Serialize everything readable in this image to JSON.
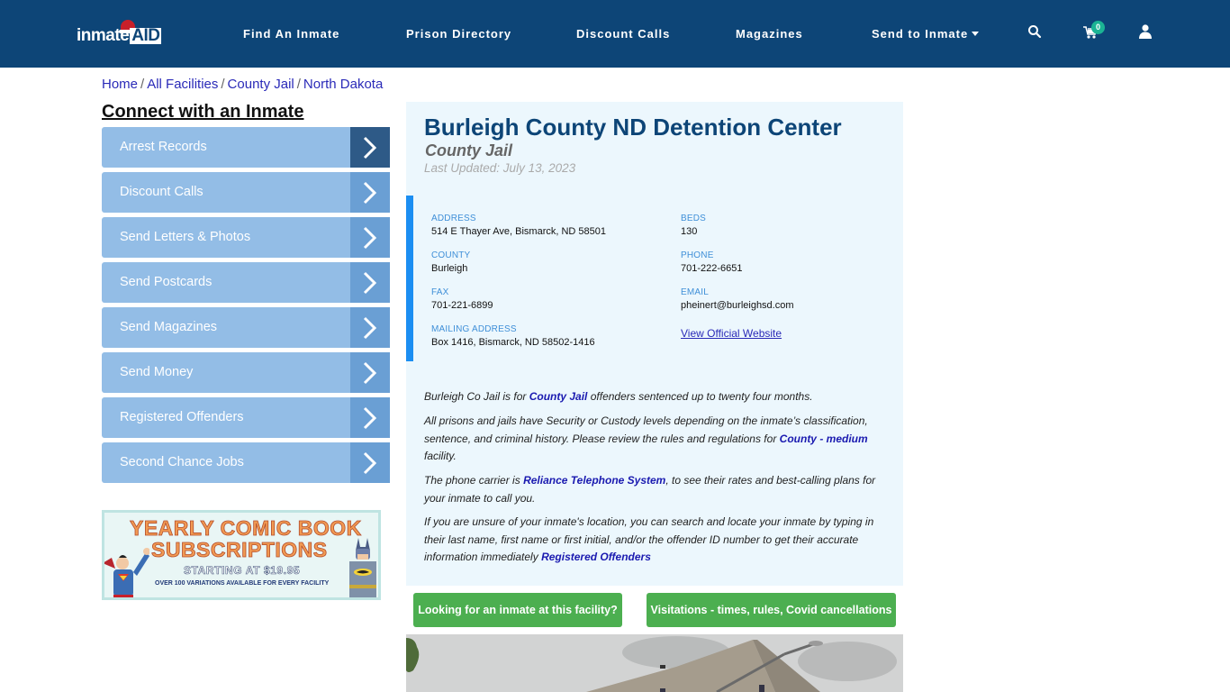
{
  "header": {
    "logo_text": "inmate",
    "logo_aid": "AID",
    "nav": [
      {
        "label": "Find An Inmate"
      },
      {
        "label": "Prison Directory"
      },
      {
        "label": "Discount Calls"
      },
      {
        "label": "Magazines"
      },
      {
        "label": "Send to Inmate",
        "has_dropdown": true
      }
    ],
    "icons": [
      "search-icon",
      "cart-icon",
      "user-icon"
    ],
    "cart_count": "0",
    "colors": {
      "bar": "#0d4577",
      "badge": "#1bb394"
    }
  },
  "breadcrumb": [
    {
      "label": "Home"
    },
    {
      "label": "All Facilities"
    },
    {
      "label": "County Jail"
    },
    {
      "label": "North Dakota"
    }
  ],
  "breadcrumb_sep": "/",
  "sidebar": {
    "title": "Connect with an Inmate",
    "items": [
      {
        "label": "Arrest Records"
      },
      {
        "label": "Discount Calls"
      },
      {
        "label": "Send Letters & Photos"
      },
      {
        "label": "Send Postcards"
      },
      {
        "label": "Send Magazines"
      },
      {
        "label": "Send Money"
      },
      {
        "label": "Registered Offenders"
      },
      {
        "label": "Second Chance Jobs"
      }
    ],
    "ad": {
      "line1": "YEARLY COMIC BOOK",
      "line2": "SUBSCRIPTIONS",
      "line3": "STARTING AT $19.95",
      "line4": "OVER 100 VARIATIONS AVAILABLE FOR EVERY FACILITY"
    }
  },
  "facility": {
    "title": "Burleigh County ND Detention Center",
    "type": "County Jail",
    "last_updated": "Last Updated: July 13, 2023",
    "info": {
      "address_label": "ADDRESS",
      "address": "514 E Thayer Ave, Bismarck, ND 58501",
      "beds_label": "BEDS",
      "beds": "130",
      "county_label": "COUNTY",
      "county": "Burleigh",
      "phone_label": "PHONE",
      "phone": "701-222-6651",
      "fax_label": "FAX",
      "fax": "701-221-6899",
      "email_label": "EMAIL",
      "email": "pheinert@burleighsd.com",
      "mailing_label": "MAILING ADDRESS",
      "mailing": "Box 1416, Bismarck, ND 58502-1416",
      "website_link": "View Official Website"
    },
    "paragraphs": {
      "p1_a": "Burleigh Co Jail is for ",
      "p1_link": "County Jail",
      "p1_b": " offenders sentenced up to twenty four months.",
      "p2_a": "All prisons and jails have Security or Custody levels depending on the inmate’s classification, sentence, and criminal history. Please review the rules and regulations for ",
      "p2_link": "County - medium",
      "p2_b": " facility.",
      "p3_a": "The phone carrier is ",
      "p3_link": "Reliance Telephone System",
      "p3_b": ", to see their rates and best-calling plans for your inmate to call you.",
      "p4_a": "If you are unsure of your inmate's location, you can search and locate your inmate by typing in their last name, first name or first initial, and/or the offender ID number to get their accurate information immediately ",
      "p4_link": "Registered Offenders"
    },
    "buttons": {
      "find_inmate": "Looking for an inmate at this facility?",
      "visitations": "Visitations - times, rules, Covid cancellations"
    }
  }
}
